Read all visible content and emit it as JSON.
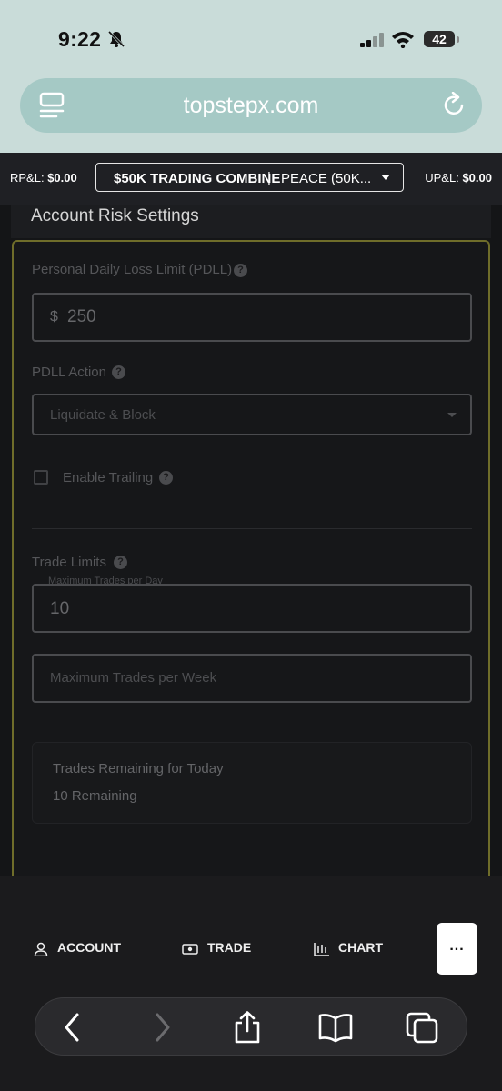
{
  "status_bar": {
    "time": "9:22",
    "battery": "42"
  },
  "browser": {
    "url": "topstepx.com"
  },
  "account_bar": {
    "rpl_label": "RP&L:",
    "rpl_value": "$0.00",
    "account_name": "$50K TRADING COMBINE",
    "separator": "|",
    "account_sub": "PEACE (50K...",
    "upl_label": "UP&L:",
    "upl_value": "$0.00"
  },
  "settings": {
    "title": "Account Risk Settings",
    "pdll_label": "Personal Daily Loss Limit (PDLL)",
    "pdll_currency": "$",
    "pdll_value": "250",
    "pdll_action_label": "PDLL Action",
    "pdll_action_value": "Liquidate & Block",
    "enable_trailing_label": "Enable Trailing",
    "enable_trailing_checked": false,
    "trade_limits_label": "Trade Limits",
    "max_trades_day_label": "Maximum Trades per Day",
    "max_trades_day_value": "10",
    "max_trades_week_placeholder": "Maximum Trades per Week",
    "remaining_title": "Trades Remaining for Today",
    "remaining_value": "10 Remaining"
  },
  "bottom_nav": {
    "account": "ACCOUNT",
    "trade": "TRADE",
    "chart": "CHART",
    "more": "..."
  },
  "colors": {
    "panel_border": "#6f6d2a",
    "status_bg": "#c9dcd9",
    "url_bar_bg": "#a5c9c5"
  }
}
